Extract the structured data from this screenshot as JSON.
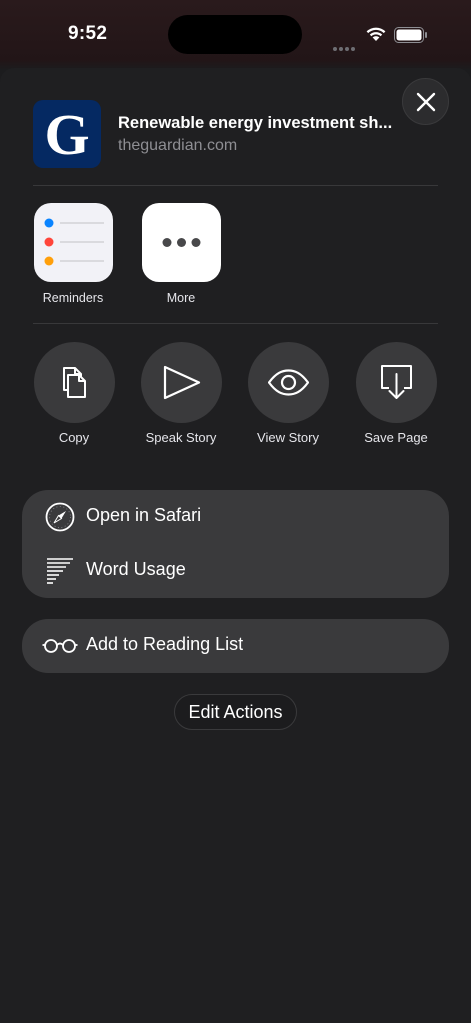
{
  "status_bar": {
    "time": "9:52"
  },
  "share_sheet": {
    "title": "Renewable energy investment sh...",
    "subtitle": "theguardian.com",
    "thumbnail_letter": "G",
    "close_icon": "close-icon"
  },
  "apps": [
    {
      "label": "Reminders",
      "icon": "reminders-app-icon"
    },
    {
      "label": "More",
      "icon": "more-ellipsis-icon"
    }
  ],
  "actions": [
    {
      "label": "Copy",
      "icon": "copy-icon"
    },
    {
      "label": "Speak Story",
      "icon": "play-icon"
    },
    {
      "label": "View Story",
      "icon": "eye-icon"
    },
    {
      "label": "Save Page",
      "icon": "download-icon"
    }
  ],
  "list_group_1": [
    {
      "label": "Open in Safari",
      "icon": "compass-icon"
    },
    {
      "label": "Word Usage",
      "icon": "text-lines-icon"
    }
  ],
  "list_group_2": [
    {
      "label": "Add to Reading List",
      "icon": "glasses-icon"
    }
  ],
  "edit_actions_label": "Edit Actions",
  "colors": {
    "sheet_background": "#1f1f21",
    "button_background": "#3a3a3c",
    "guardian_blue": "#052962",
    "reminder_blue": "#0a84ff",
    "reminder_red": "#ff453a",
    "reminder_orange": "#ff9f0a"
  }
}
